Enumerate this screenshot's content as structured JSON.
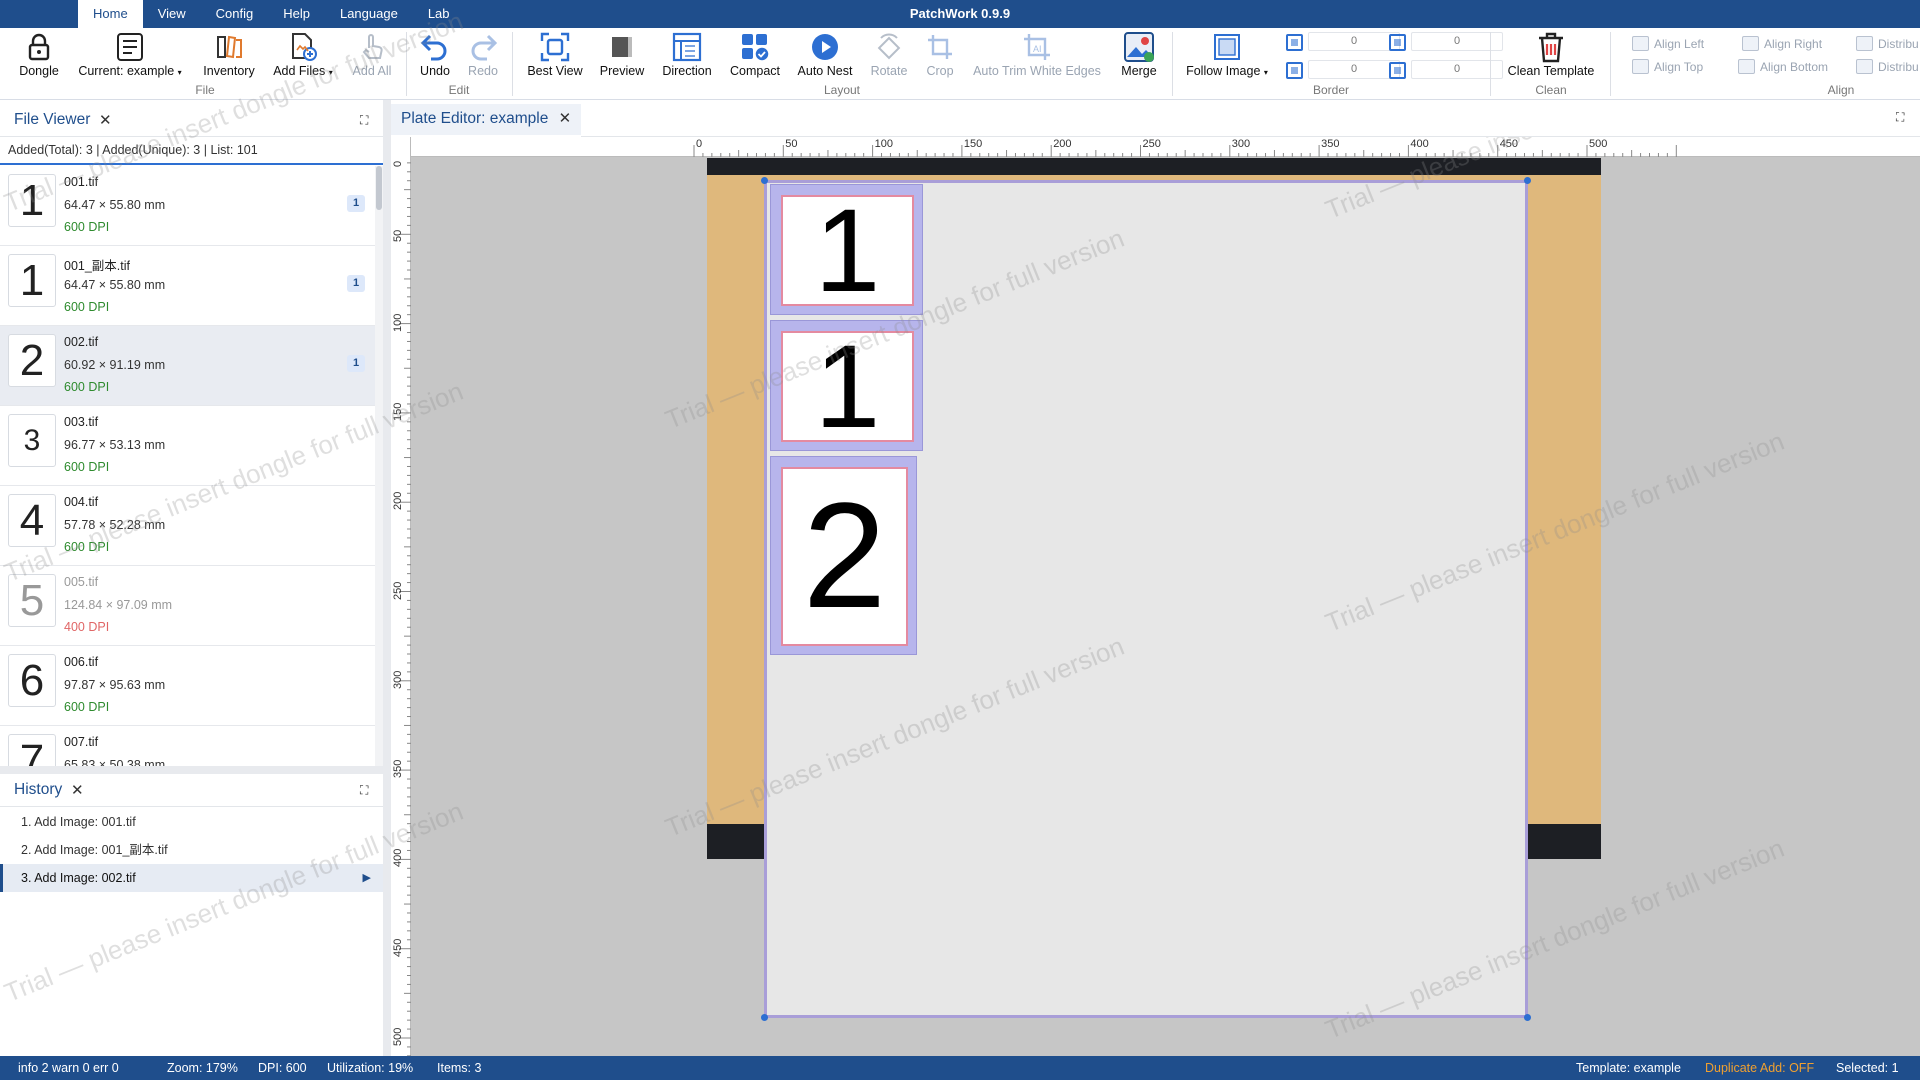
{
  "app": {
    "title": "PatchWork 0.9.9"
  },
  "menu": [
    "Home",
    "View",
    "Config",
    "Help",
    "Language",
    "Lab"
  ],
  "ribbon": {
    "file": {
      "dongle": "Dongle",
      "current": "Current: example",
      "inventory": "Inventory",
      "add_files": "Add Files",
      "add_all": "Add All",
      "group": "File"
    },
    "edit": {
      "undo": "Undo",
      "redo": "Redo",
      "group": "Edit"
    },
    "layout": {
      "best_view": "Best View",
      "preview": "Preview",
      "direction": "Direction",
      "compact": "Compact",
      "auto_nest": "Auto Nest",
      "rotate": "Rotate",
      "crop": "Crop",
      "auto_trim": "Auto Trim White Edges",
      "merge": "Merge",
      "group": "Layout"
    },
    "border": {
      "follow_image": "Follow Image",
      "values": [
        "0",
        "0",
        "0",
        "0"
      ],
      "group": "Border"
    },
    "clean": {
      "clean_template": "Clean Template",
      "group": "Clean"
    },
    "align": {
      "align_left": "Align Left",
      "align_top": "Align Top",
      "align_right": "Align Right",
      "align_bottom": "Align Bottom",
      "distribute_1": "Distribu",
      "distribute_2": "Distribu",
      "group": "Align"
    }
  },
  "file_viewer": {
    "title": "File Viewer",
    "stats": "Added(Total): 3 | Added(Unique): 3 | List: 101",
    "files": [
      {
        "thumb": "1",
        "name": "001.tif",
        "size": "64.47 × 55.80 mm",
        "dpi": "600 DPI",
        "count": "1"
      },
      {
        "thumb": "1",
        "name": "001_副本.tif",
        "size": "64.47 × 55.80 mm",
        "dpi": "600 DPI",
        "count": "1"
      },
      {
        "thumb": "2",
        "name": "002.tif",
        "size": "60.92 × 91.19 mm",
        "dpi": "600 DPI",
        "count": "1"
      },
      {
        "thumb": "3",
        "name": "003.tif",
        "size": "96.77 × 53.13 mm",
        "dpi": "600 DPI"
      },
      {
        "thumb": "4",
        "name": "004.tif",
        "size": "57.78 × 52.28 mm",
        "dpi": "600 DPI"
      },
      {
        "thumb": "5",
        "name": "005.tif",
        "size": "124.84 × 97.09 mm",
        "dpi": "400 DPI"
      },
      {
        "thumb": "6",
        "name": "006.tif",
        "size": "97.87 × 95.63 mm",
        "dpi": "600 DPI"
      },
      {
        "thumb": "7",
        "name": "007.tif",
        "size": "65.83 × 50.38 mm"
      }
    ]
  },
  "history": {
    "title": "History",
    "items": [
      "1. Add Image: 001.tif",
      "2. Add Image: 001_副本.tif",
      "3. Add Image: 002.tif"
    ]
  },
  "editor": {
    "tab_title": "Plate Editor: example",
    "ruler_top": [
      "0",
      "50",
      "100",
      "150",
      "200",
      "250",
      "300",
      "350",
      "400",
      "450",
      "500"
    ],
    "ruler_left": [
      "0",
      "50",
      "100",
      "150",
      "200",
      "250",
      "300",
      "350",
      "400",
      "450",
      "500"
    ],
    "plate_items": [
      "1",
      "1",
      "2"
    ],
    "watermark": "Trial — please insert dongle for full version"
  },
  "status": {
    "log": "info 2  warn 0  err 0",
    "zoom": "Zoom: 179%",
    "dpi": "DPI: 600",
    "utilization": "Utilization: 19%",
    "items": "Items: 3",
    "template": "Template: example",
    "duplicate": "Duplicate Add: OFF",
    "selected": "Selected: 1"
  },
  "colors": {
    "brand": "#1f4e8c",
    "accent": "#2d6fd2",
    "plate_margin": "#dfb87c",
    "item_fill": "#b7b5ec",
    "warning": "#f0a030"
  }
}
